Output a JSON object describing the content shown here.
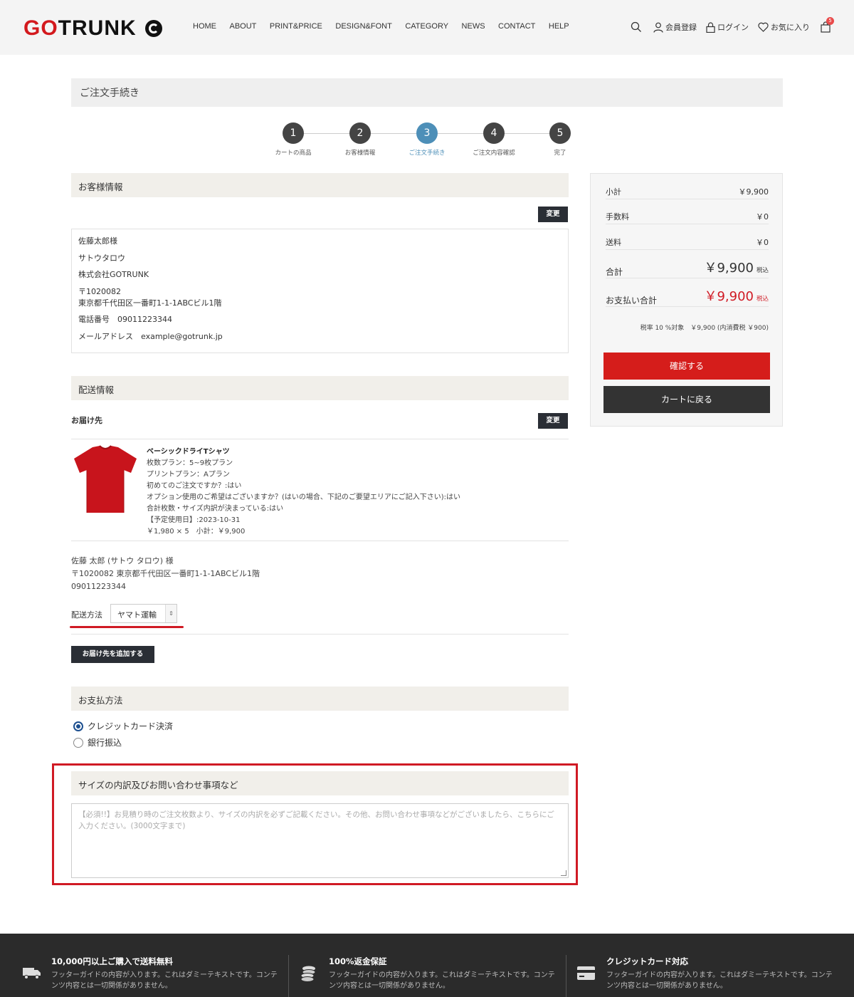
{
  "header": {
    "logo_text": "GOTRUNK",
    "nav": [
      "HOME",
      "ABOUT",
      "PRINT&PRICE",
      "DESIGN&FONT",
      "CATEGORY",
      "NEWS",
      "CONTACT",
      "HELP"
    ],
    "member_register": "会員登録",
    "login": "ログイン",
    "favorites": "お気に入り",
    "cart_count": "5"
  },
  "page": {
    "title": "ご注文手続き"
  },
  "steps": [
    {
      "num": "1",
      "label": "カートの商品"
    },
    {
      "num": "2",
      "label": "お客様情報"
    },
    {
      "num": "3",
      "label": "ご注文手続き"
    },
    {
      "num": "4",
      "label": "ご注文内容確認"
    },
    {
      "num": "5",
      "label": "完了"
    }
  ],
  "customer": {
    "heading": "お客様情報",
    "change_label": "変更",
    "name": "佐藤太郎様",
    "kana": "サトウタロウ",
    "company": "株式会社GOTRUNK",
    "postal": "〒1020082",
    "address": "東京都千代田区一番町1-1-1ABCビル1階",
    "phone": "電話番号　09011223344",
    "email": "メールアドレス　example@gotrunk.jp"
  },
  "delivery": {
    "heading": "配送情報",
    "destination_label": "お届け先",
    "change_label": "変更",
    "product": {
      "name": "ベーシックドライTシャツ",
      "lines": [
        "枚数プラン：5~9枚プラン",
        "プリントプラン：Aプラン",
        "初めてのご注文ですか？:はい",
        "オプション使用のご希望はございますか？(はいの場合、下記のご要望エリアにご記入下さい):はい",
        "合計枚数・サイズ内訳が決まっている:はい",
        "【予定使用日】:2023-10-31",
        "￥1,980 × 5　小計：￥9,900"
      ]
    },
    "recipient": "佐藤 太郎 (サトウ タロウ) 様",
    "recipient_address": "〒1020082 東京都千代田区一番町1-1-1ABCビル1階",
    "recipient_phone": "09011223344",
    "shipping_method_label": "配送方法",
    "shipping_method_value": "ヤマト運輸",
    "add_destination": "お届け先を追加する"
  },
  "payment": {
    "heading": "お支払方法",
    "options": [
      {
        "label": "クレジットカード決済",
        "selected": true
      },
      {
        "label": "銀行振込",
        "selected": false
      }
    ]
  },
  "notes": {
    "heading": "サイズの内訳及びお問い合わせ事項など",
    "placeholder": "【必須!!】お見積り時のご注文枚数より、サイズの内訳を必ずご記載ください。その他、お問い合わせ事項などがございましたら、こちらにご入力ください。(3000文字まで)"
  },
  "summary": {
    "subtotal_label": "小計",
    "subtotal": "￥9,900",
    "fee_label": "手数料",
    "fee": "￥0",
    "shipping_label": "送料",
    "shipping": "￥0",
    "total_label": "合計",
    "total": "￥9,900",
    "total_tax": "税込",
    "pay_total_label": "お支払い合計",
    "pay_total": "￥9,900",
    "pay_total_tax": "税込",
    "tax_note": "税率 10 %対象　￥9,900 (内消費税 ￥900)",
    "confirm_button": "確認する",
    "back_button": "カートに戻る"
  },
  "footer": [
    {
      "title": "10,000円以上ご購入で送料無料",
      "text": "フッターガイドの内容が入ります。これはダミーテキストです。コンテンツ内容とは一切関係がありません。",
      "icon": "truck-icon"
    },
    {
      "title": "100%返金保証",
      "text": "フッターガイドの内容が入ります。これはダミーテキストです。コンテンツ内容とは一切関係がありません。",
      "icon": "coins-icon"
    },
    {
      "title": "クレジットカード対応",
      "text": "フッターガイドの内容が入ります。これはダミーテキストです。コンテンツ内容とは一切関係がありません。",
      "icon": "credit-card-icon"
    }
  ],
  "colors": {
    "accent_red": "#d51d1b",
    "step_active": "#4d8fb8",
    "dark_button": "#2a2e35"
  }
}
